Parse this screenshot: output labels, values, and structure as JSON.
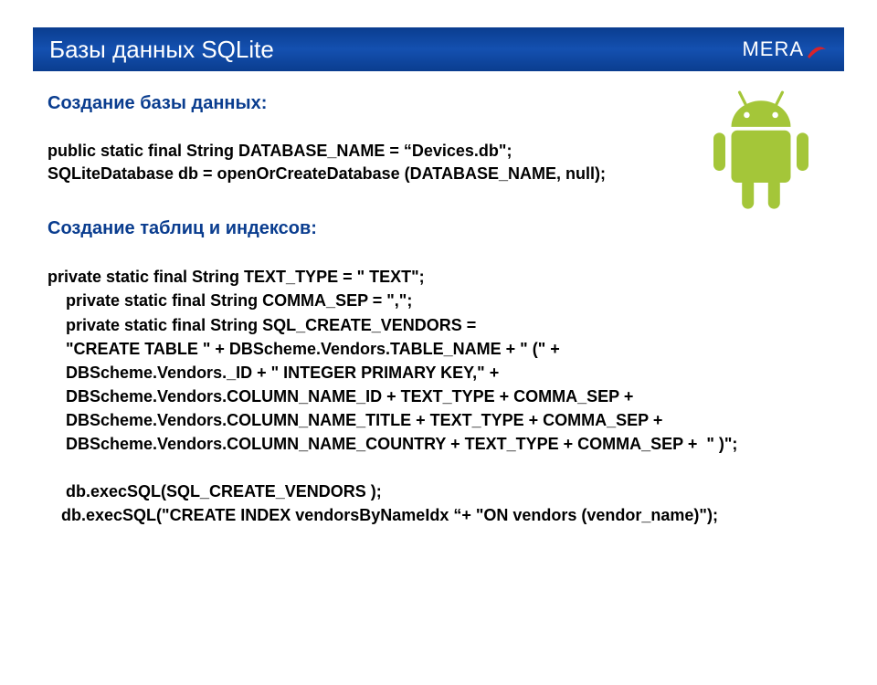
{
  "header": {
    "title": "Базы данных SQLite",
    "logo_text": "MERA"
  },
  "section1": {
    "heading": "Создание базы данных:",
    "code": "public static final String DATABASE_NAME = “Devices.db\";\nSQLiteDatabase db = openOrCreateDatabase (DATABASE_NAME, null);"
  },
  "section2": {
    "heading": "Создание таблиц и индексов:",
    "code": "private static final String TEXT_TYPE = \" TEXT\";\n    private static final String COMMA_SEP = \",\";\n    private static final String SQL_CREATE_VENDORS =\n    \"CREATE TABLE \" + DBScheme.Vendors.TABLE_NAME + \" (\" +\n    DBScheme.Vendors._ID + \" INTEGER PRIMARY KEY,\" +\n    DBScheme.Vendors.COLUMN_NAME_ID + TEXT_TYPE + COMMA_SEP +\n    DBScheme.Vendors.COLUMN_NAME_TITLE + TEXT_TYPE + COMMA_SEP +\n    DBScheme.Vendors.COLUMN_NAME_COUNTRY + TEXT_TYPE + COMMA_SEP +  \" )\";\n\n    db.execSQL(SQL_CREATE_VENDORS );\n   db.execSQL(\"CREATE INDEX vendorsByNameIdx “+ \"ON vendors (vendor_name)\");"
  }
}
